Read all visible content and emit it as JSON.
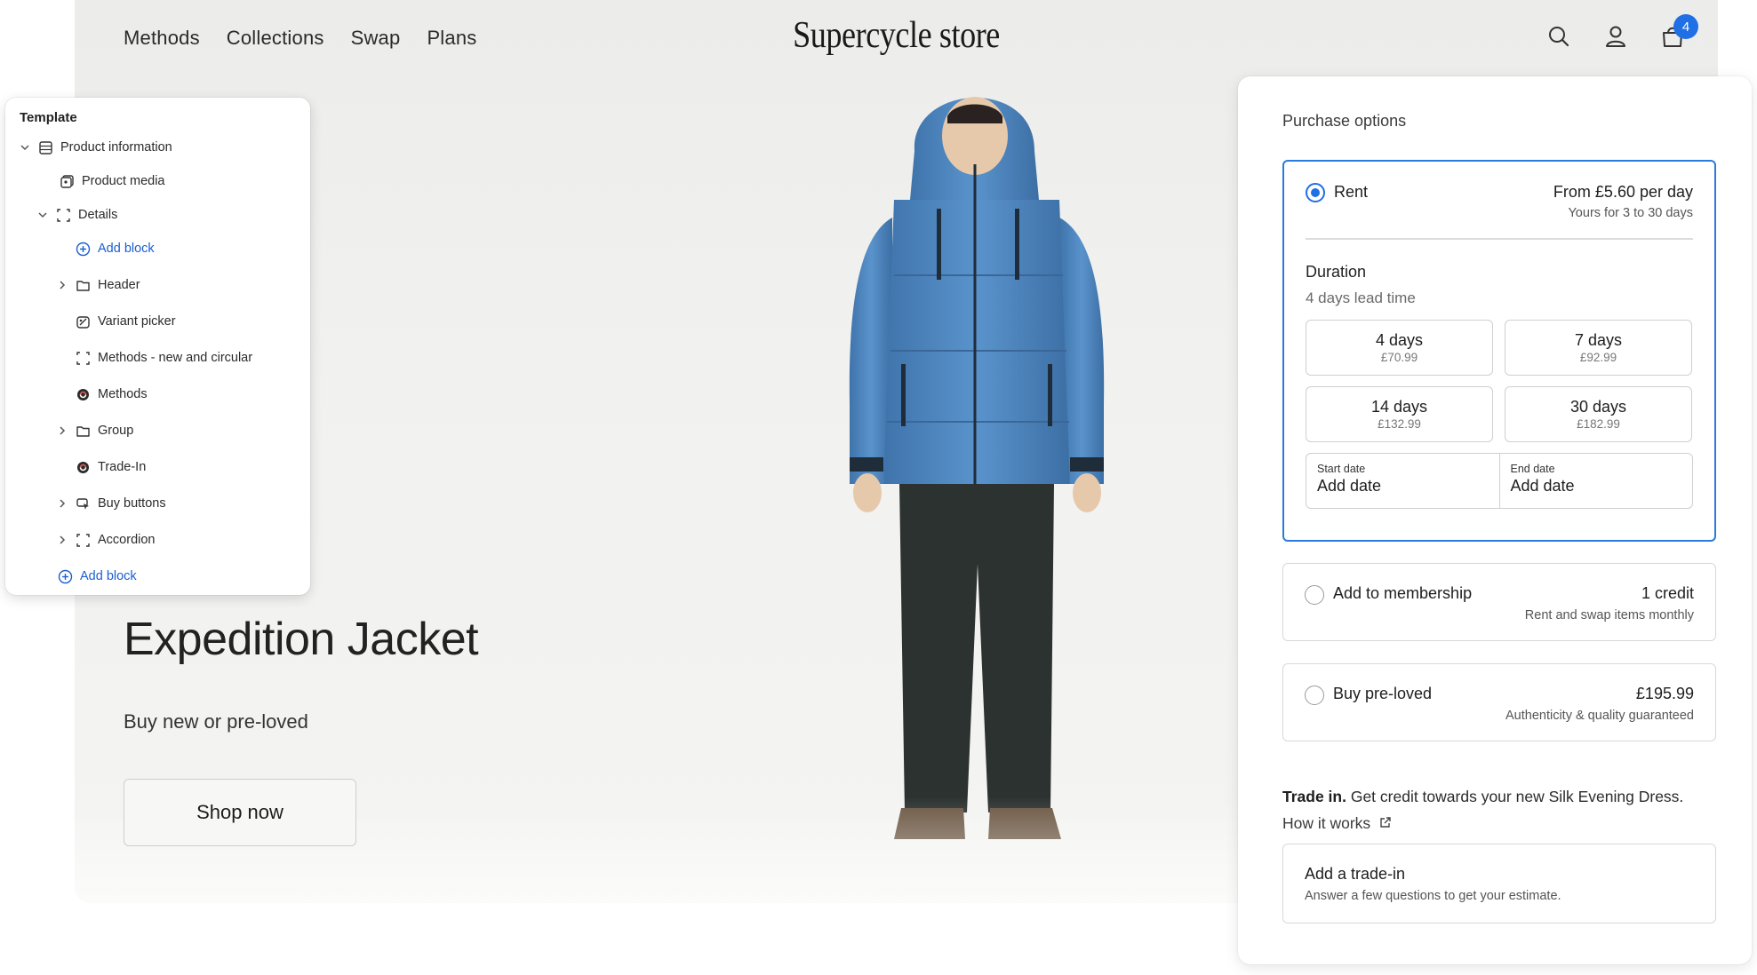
{
  "colors": {
    "accent": "#1f6fe5",
    "selected_border": "#2a7bdc",
    "link": "#1a5fd0",
    "jacket": "#4f86bd"
  },
  "store": {
    "brand": "Supercycle store",
    "nav": [
      "Methods",
      "Collections",
      "Swap",
      "Plans"
    ],
    "icons": [
      "search-icon",
      "account-icon",
      "cart-icon"
    ],
    "cart_count": "4",
    "hero": {
      "title": "Expedition Jacket",
      "subtitle": "Buy new or pre-loved",
      "cta": "Shop now"
    }
  },
  "template": {
    "title": "Template",
    "items": [
      {
        "label": "Product information",
        "icon": "section-icon",
        "chevron": "expanded"
      },
      {
        "label": "Product media",
        "icon": "media-icon"
      },
      {
        "label": "Details",
        "icon": "group-icon",
        "chevron": "expanded"
      },
      {
        "label": "Add block",
        "icon": "plus-circle-icon"
      },
      {
        "label": "Header",
        "icon": "folder-icon",
        "chevron": "collapsed"
      },
      {
        "label": "Variant picker",
        "icon": "variant-icon"
      },
      {
        "label": "Methods - new and circular",
        "icon": "group-icon"
      },
      {
        "label": "Methods",
        "icon": "app-block-icon"
      },
      {
        "label": "Group",
        "icon": "folder-icon",
        "chevron": "collapsed"
      },
      {
        "label": "Trade-In",
        "icon": "app-block-icon"
      },
      {
        "label": "Buy buttons",
        "icon": "buy-buttons-icon",
        "chevron": "collapsed"
      },
      {
        "label": "Accordion",
        "icon": "group-icon",
        "chevron": "collapsed"
      },
      {
        "label": "Add block",
        "icon": "plus-circle-icon"
      }
    ]
  },
  "purchase": {
    "heading": "Purchase options",
    "rent": {
      "label": "Rent",
      "price": "From £5.60 per day",
      "note": "Yours for 3 to 30 days",
      "selected": true,
      "duration_title": "Duration",
      "lead_time": "4 days lead time",
      "durations": [
        {
          "days": "4 days",
          "price": "£70.99"
        },
        {
          "days": "7 days",
          "price": "£92.99"
        },
        {
          "days": "14 days",
          "price": "£132.99"
        },
        {
          "days": "30 days",
          "price": "£182.99"
        }
      ],
      "start_caption": "Start date",
      "start_value": "Add date",
      "end_caption": "End date",
      "end_value": "Add date"
    },
    "membership": {
      "label": "Add to membership",
      "price": "1 credit",
      "note": "Rent and swap items monthly",
      "selected": false
    },
    "preloved": {
      "label": "Buy pre-loved",
      "price": "£195.99",
      "note": "Authenticity & quality guaranteed",
      "selected": false
    },
    "trade": {
      "bold": "Trade in.",
      "text": " Get credit towards your new Silk Evening Dress.",
      "link": "How it works",
      "card_title": "Add a trade-in",
      "card_sub": "Answer a few questions to get your estimate."
    }
  }
}
